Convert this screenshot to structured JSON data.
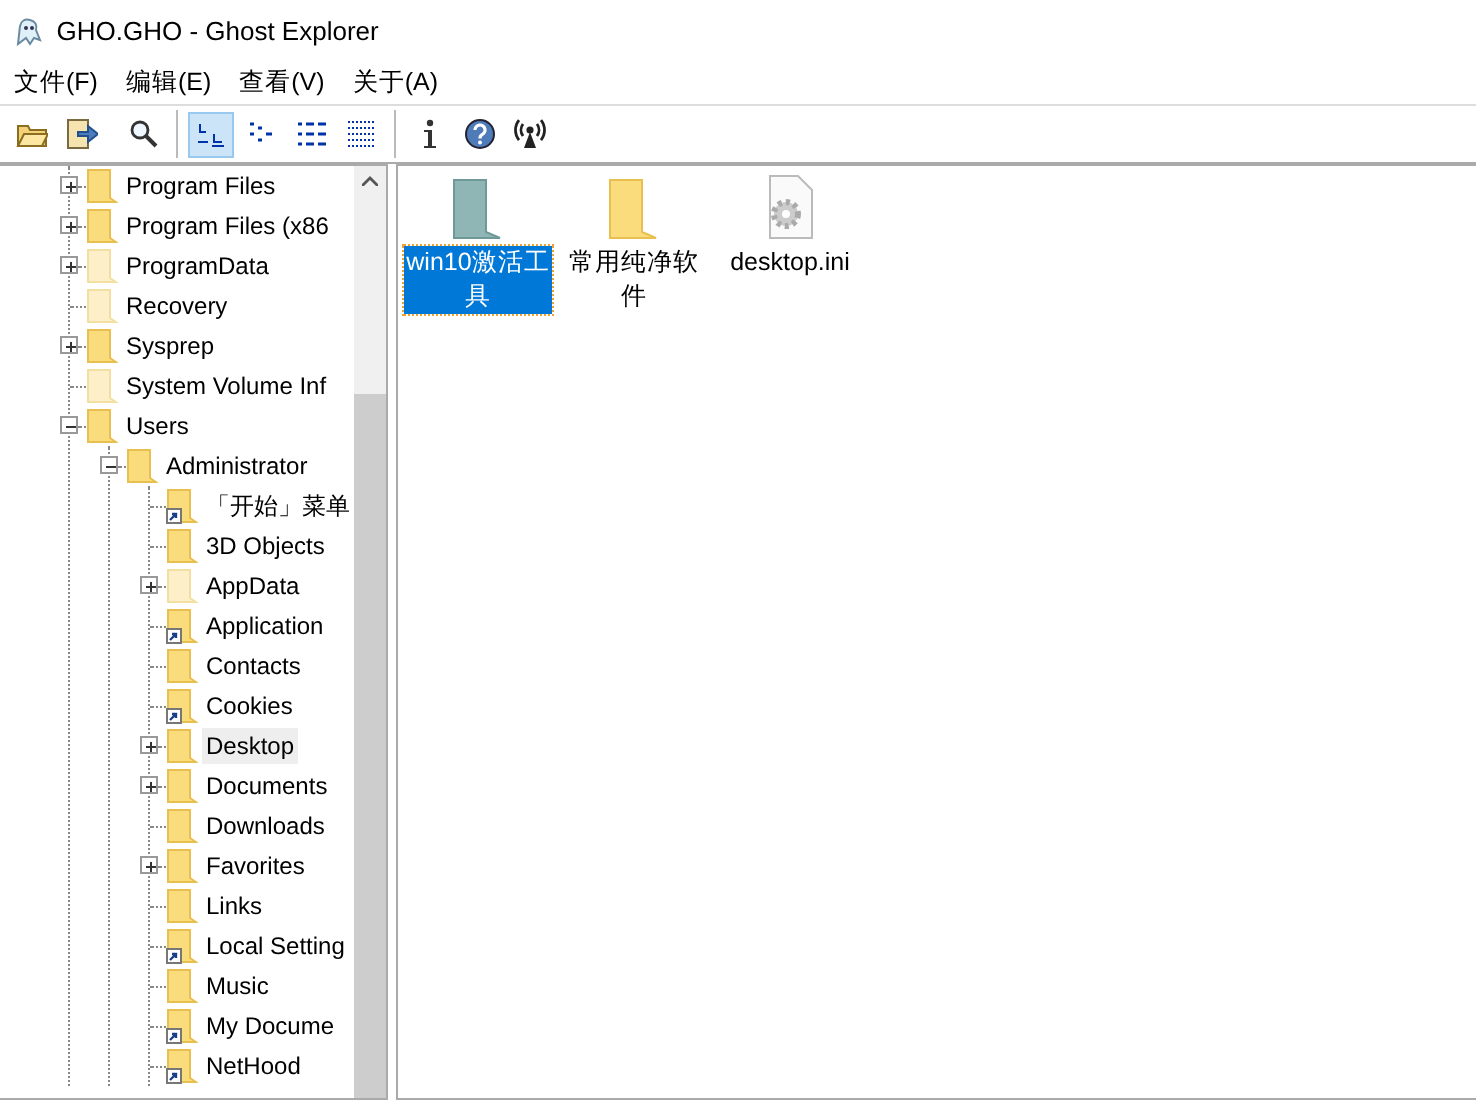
{
  "window": {
    "title": "GHO.GHO - Ghost Explorer"
  },
  "menu": [
    "文件(F)",
    "编辑(E)",
    "查看(V)",
    "关于(A)"
  ],
  "toolbar": [
    {
      "kind": "open",
      "selected": false
    },
    {
      "kind": "export",
      "selected": false
    },
    {
      "kind": "search",
      "selected": false
    },
    {
      "kind": "sep"
    },
    {
      "kind": "large-icons",
      "selected": true
    },
    {
      "kind": "small-icons",
      "selected": false
    },
    {
      "kind": "list",
      "selected": false
    },
    {
      "kind": "details",
      "selected": false
    },
    {
      "kind": "sep"
    },
    {
      "kind": "info",
      "selected": false
    },
    {
      "kind": "help",
      "selected": false
    },
    {
      "kind": "antenna",
      "selected": false
    }
  ],
  "tree": [
    {
      "label": "Program Files",
      "expanded": false,
      "hidden": false,
      "shortcut": false,
      "selected": false
    },
    {
      "label": "Program Files (x86",
      "expanded": false,
      "hidden": false,
      "shortcut": false,
      "selected": false
    },
    {
      "label": "ProgramData",
      "expanded": false,
      "hidden": true,
      "shortcut": false,
      "selected": false
    },
    {
      "label": "Recovery",
      "hidden": true,
      "shortcut": false,
      "selected": false
    },
    {
      "label": "Sysprep",
      "expanded": false,
      "hidden": false,
      "shortcut": false,
      "selected": false
    },
    {
      "label": "System Volume Inf",
      "hidden": true,
      "shortcut": false,
      "selected": false
    },
    {
      "label": "Users",
      "expanded": true,
      "hidden": false,
      "shortcut": false,
      "selected": false,
      "children": [
        {
          "label": "Administrator",
          "expanded": true,
          "hidden": false,
          "shortcut": false,
          "selected": false,
          "children": [
            {
              "label": "「开始」菜单",
              "hidden": false,
              "shortcut": true,
              "selected": false
            },
            {
              "label": "3D Objects",
              "hidden": false,
              "shortcut": false,
              "selected": false
            },
            {
              "label": "AppData",
              "expanded": false,
              "hidden": true,
              "shortcut": false,
              "selected": false
            },
            {
              "label": "Application",
              "hidden": false,
              "shortcut": true,
              "selected": false
            },
            {
              "label": "Contacts",
              "hidden": false,
              "shortcut": false,
              "selected": false
            },
            {
              "label": "Cookies",
              "hidden": false,
              "shortcut": true,
              "selected": false
            },
            {
              "label": "Desktop",
              "expanded": false,
              "hidden": false,
              "shortcut": false,
              "selected": true
            },
            {
              "label": "Documents",
              "expanded": false,
              "hidden": false,
              "shortcut": false,
              "selected": false
            },
            {
              "label": "Downloads",
              "hidden": false,
              "shortcut": false,
              "selected": false
            },
            {
              "label": "Favorites",
              "expanded": false,
              "hidden": false,
              "shortcut": false,
              "selected": false
            },
            {
              "label": "Links",
              "hidden": false,
              "shortcut": false,
              "selected": false
            },
            {
              "label": "Local Setting",
              "hidden": false,
              "shortcut": true,
              "selected": false
            },
            {
              "label": "Music",
              "hidden": false,
              "shortcut": false,
              "selected": false
            },
            {
              "label": "My Docume",
              "hidden": false,
              "shortcut": true,
              "selected": false
            },
            {
              "label": "NetHood",
              "hidden": false,
              "shortcut": true,
              "selected": false
            }
          ]
        }
      ]
    }
  ],
  "files": [
    {
      "name": "win10激活工具",
      "kind": "folder-teal",
      "selected": true
    },
    {
      "name": "常用纯净软件",
      "kind": "folder",
      "selected": false
    },
    {
      "name": "desktop.ini",
      "kind": "settings-file",
      "selected": false
    }
  ]
}
